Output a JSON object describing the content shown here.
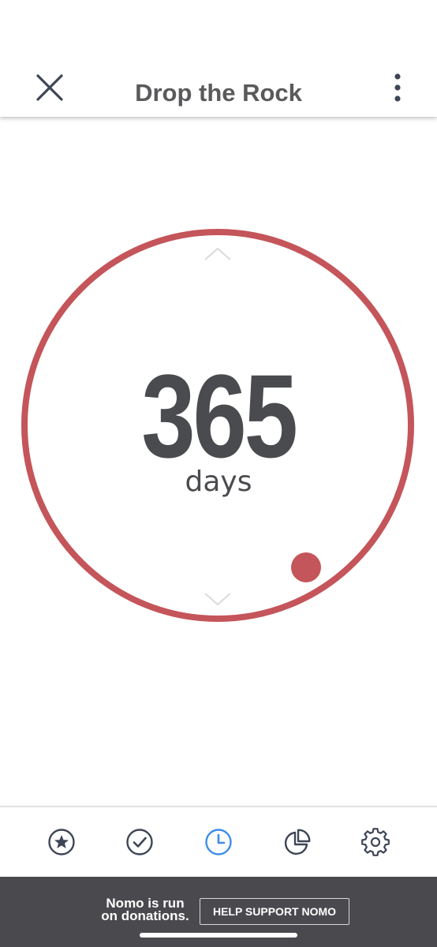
{
  "header": {
    "title": "Drop the Rock",
    "close_icon": "close-icon",
    "more_icon": "more-vertical-icon"
  },
  "counter": {
    "value": "365",
    "unit": "days",
    "ring_color": "#c4555a",
    "up_icon": "chevron-up-icon",
    "down_icon": "chevron-down-icon"
  },
  "tabbar": {
    "items": [
      {
        "icon": "star-icon",
        "active": false
      },
      {
        "icon": "checkmark-icon",
        "active": false
      },
      {
        "icon": "clock-icon",
        "active": true
      },
      {
        "icon": "pie-chart-icon",
        "active": false
      },
      {
        "icon": "gear-icon",
        "active": false
      }
    ],
    "active_color": "#3d8ee6",
    "inactive_color": "#3e4556"
  },
  "banner": {
    "line1": "Nomo is run",
    "line2": "on donations.",
    "button_label": "HELP SUPPORT NOMO"
  }
}
